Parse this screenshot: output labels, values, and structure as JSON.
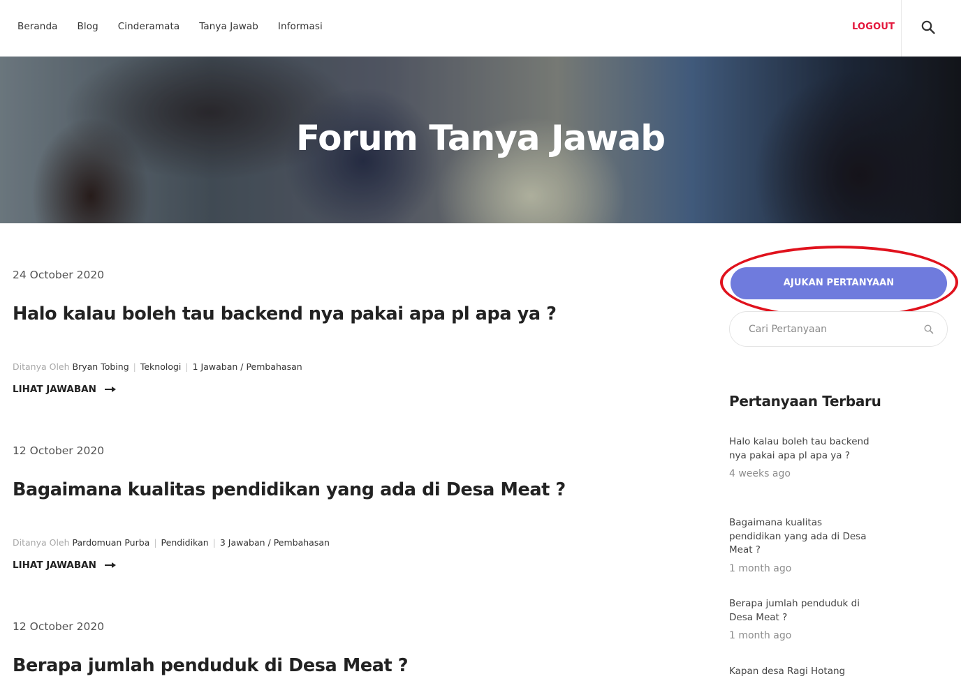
{
  "nav": {
    "links": [
      "Beranda",
      "Blog",
      "Cinderamata",
      "Tanya Jawab",
      "Informasi"
    ],
    "logout_label": "LOGOUT"
  },
  "hero": {
    "title": "Forum Tanya Jawab"
  },
  "posts": [
    {
      "date": "24 October 2020",
      "title": "Halo kalau boleh tau backend nya pakai apa pl apa ya ?",
      "asked_by_label": "Ditanya Oleh",
      "author": "Bryan Tobing",
      "category": "Teknologi",
      "answers": "1 Jawaban / Pembahasan",
      "link_label": "LIHAT JAWABAN"
    },
    {
      "date": "12 October 2020",
      "title": "Bagaimana kualitas pendidikan yang ada di Desa Meat ?",
      "asked_by_label": "Ditanya Oleh",
      "author": "Pardomuan Purba",
      "category": "Pendidikan",
      "answers": "3 Jawaban / Pembahasan",
      "link_label": "LIHAT JAWABAN"
    },
    {
      "date": "12 October 2020",
      "title": "Berapa jumlah penduduk di Desa Meat ?"
    }
  ],
  "sidebar": {
    "ask_button": "AJUKAN PERTANYAAN",
    "search_placeholder": "Cari Pertanyaan",
    "recent_title": "Pertanyaan Terbaru",
    "recent": [
      {
        "title": "Halo kalau boleh tau backend nya pakai apa pl apa ya ?",
        "time": "4 weeks ago"
      },
      {
        "title": "Bagaimana kualitas pendidikan yang ada di Desa Meat ?",
        "time": "1 month ago"
      },
      {
        "title": "Berapa jumlah penduduk di Desa Meat ?",
        "time": "1 month ago"
      },
      {
        "title": "Kapan desa Ragi Hotang"
      }
    ]
  },
  "colors": {
    "accent_button": "#6f7bdd",
    "logout": "#e3163b",
    "highlight_ring": "#e0121d"
  }
}
